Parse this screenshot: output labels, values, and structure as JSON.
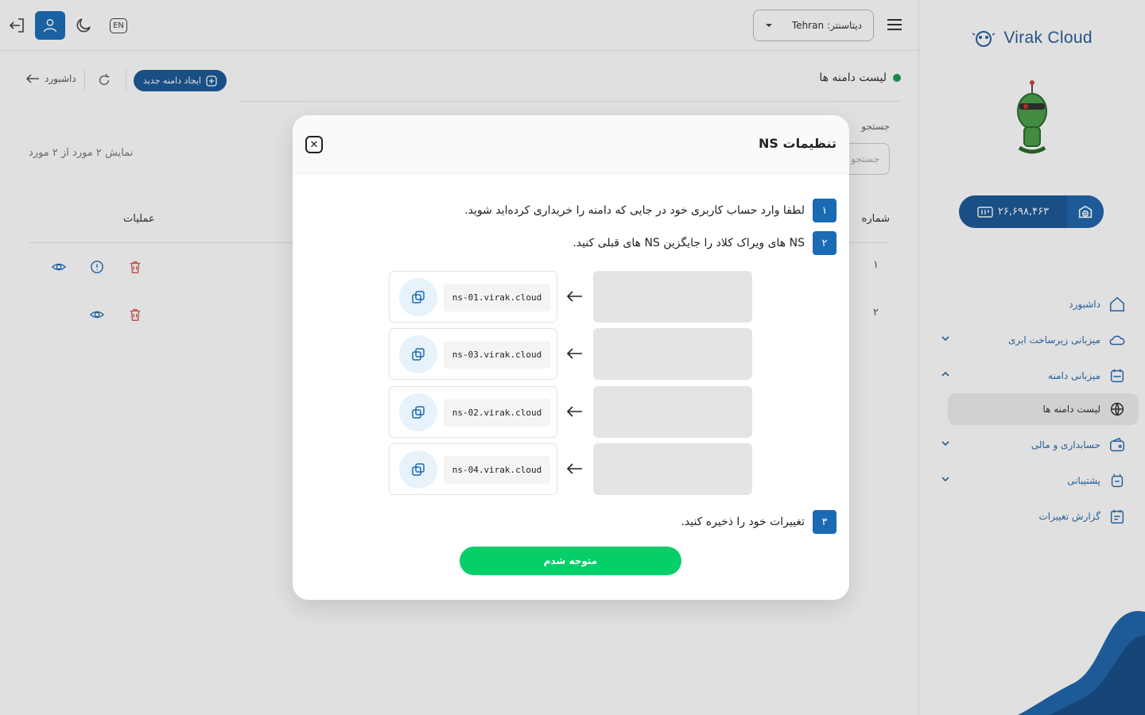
{
  "brand": {
    "name": "Virak Cloud"
  },
  "wallet": {
    "amount": "۲۶,۶۹۸,۴۶۳"
  },
  "sidebar": {
    "items": [
      {
        "label": "داشبورد",
        "icon": "home-icon"
      },
      {
        "label": "میزبانی زیرساخت ابری",
        "icon": "cloud-icon"
      },
      {
        "label": "میزبانی دامنه",
        "icon": "domain-icon"
      },
      {
        "label": "لیست دامنه ها",
        "icon": "globe-www-icon"
      },
      {
        "label": "حسابداری و مالی",
        "icon": "wallet-icon"
      },
      {
        "label": "پشتیبانی",
        "icon": "support-icon"
      },
      {
        "label": "گزارش تغییرات",
        "icon": "changelog-icon"
      }
    ]
  },
  "header": {
    "datacenter_label": "دیتاسنتر:",
    "datacenter_value": "Tehran",
    "lang": "EN"
  },
  "page": {
    "title": "لیست دامنه ها",
    "new_domain_button": "ایجاد دامنه جدید",
    "back_label": "داشبورد",
    "search_label": "جستجو",
    "search_placeholder": "جستجو",
    "count_text": "نمایش ۲ مورد از ۲ مورد",
    "columns": {
      "number": "شماره",
      "actions": "عملیات"
    },
    "rows": [
      {
        "num": "۱"
      },
      {
        "num": "۲"
      }
    ]
  },
  "modal": {
    "title": "تنظیمات NS",
    "steps": [
      {
        "num": "۱",
        "text": "لطفا وارد حساب کاربری خود در جایی که دامنه را خریداری کرده‌اید شوید."
      },
      {
        "num": "۲",
        "text": "NS های ویراک کلاد را جایگزین NS های قبلی کنید."
      },
      {
        "num": "۳",
        "text": "تغییرات خود را ذخیره کنید."
      }
    ],
    "nameservers": [
      "ns-01.virak.cloud",
      "ns-03.virak.cloud",
      "ns-02.virak.cloud",
      "ns-04.virak.cloud"
    ],
    "confirm_button": "متوجه شدم"
  },
  "colors": {
    "primary": "#1e5b99",
    "accent": "#1a6ab4",
    "success": "#06cf6a",
    "danger": "#d9534f"
  }
}
